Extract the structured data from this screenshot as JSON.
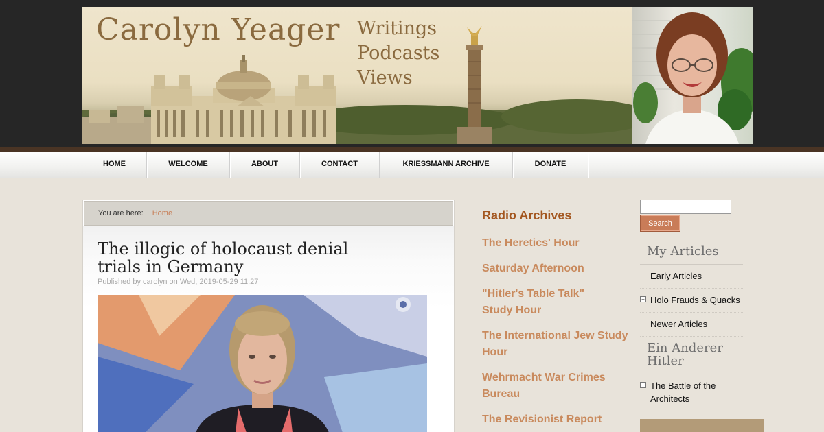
{
  "header": {
    "site_name": "Carolyn Yeager",
    "tagline": [
      "Writings",
      "Podcasts",
      "Views"
    ]
  },
  "nav": {
    "items": [
      "HOME",
      "WELCOME",
      "ABOUT",
      "CONTACT",
      "KRIESSMANN ARCHIVE",
      "DONATE"
    ]
  },
  "breadcrumb": {
    "prefix": "You are here:",
    "home": "Home"
  },
  "article": {
    "title": "The illogic of holocaust denial trials in Germany",
    "published": "Published by carolyn on Wed, 2019-05-29 11:27"
  },
  "radio_archives": {
    "heading": "Radio Archives",
    "links": [
      "The Heretics' Hour",
      "Saturday Afternoon",
      "\"Hitler's Table Talk\" Study Hour",
      "The International Jew Study Hour",
      "Wehrmacht War Crimes Bureau",
      "The Revisionist Report"
    ]
  },
  "sidebar": {
    "search_button": "Search",
    "my_articles": {
      "heading": "My Articles",
      "items": [
        "Early Articles",
        "Holo Frauds & Quacks",
        "Newer Articles"
      ]
    },
    "ein_anderer": {
      "heading": "Ein Anderer Hitler",
      "items": [
        "The Battle of the Architects"
      ]
    }
  },
  "colors": {
    "accent": "#c98a5d",
    "heading_accent": "#a3561f",
    "search_button": "#c97c58",
    "header_bg": "#262626",
    "nav_brown": "#4a3424"
  }
}
